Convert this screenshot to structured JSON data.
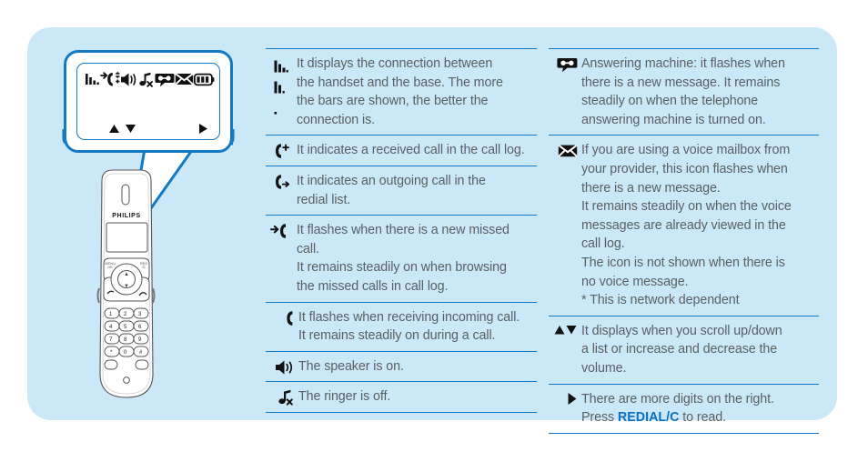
{
  "panel": {
    "background_color": "#cbe8f9",
    "accent_color": "#1479c4",
    "text_color": "#5a5f63",
    "highlight_color": "#0a6fc2"
  },
  "illustration": {
    "callout_label": "handset-display-callout",
    "brand": "PHILIPS",
    "display_icons": [
      "signal-bars-icon",
      "missed-call-icon",
      "speaker-on-icon",
      "ringer-off-icon",
      "answering-machine-icon",
      "voice-mail-icon",
      "battery-icon"
    ],
    "display_bottom_icons": [
      "scroll-up-icon",
      "scroll-down-icon",
      "more-digits-right-icon"
    ],
    "keypad_keys": [
      "1",
      "2",
      "3",
      "4",
      "5",
      "6",
      "7",
      "8",
      "9",
      "*",
      "0",
      "#"
    ]
  },
  "left_column": {
    "rows": [
      {
        "icon": "signal-bars-icon",
        "lines": [
          "It displays the connection between",
          "the handset and the base. The more",
          "the bars are shown, the better the",
          "connection is."
        ]
      },
      {
        "icon": "received-call-icon",
        "lines": [
          "It indicates a received call in the call log."
        ]
      },
      {
        "icon": "outgoing-call-icon",
        "lines": [
          "It indicates an outgoing call in the",
          "redial list."
        ]
      },
      {
        "icon": "missed-call-icon",
        "lines": [
          "It flashes when there is a new missed",
          "call.",
          "It remains steadily on when browsing",
          "the missed calls in call log."
        ]
      },
      {
        "icon": "incoming-call-icon",
        "lines": [
          "It flashes when receiving incoming call.",
          "It remains steadily on during a call."
        ]
      },
      {
        "icon": "speaker-on-icon",
        "lines": [
          "The speaker is on."
        ]
      },
      {
        "icon": "ringer-off-icon",
        "lines": [
          "The ringer is off."
        ]
      }
    ]
  },
  "right_column": {
    "rows": [
      {
        "icon": "answering-machine-icon",
        "lines": [
          "Answering machine: it flashes when",
          "there is a new message. It remains",
          "steadily on when the telephone",
          "answering machine is turned on."
        ]
      },
      {
        "icon": "voice-mail-icon",
        "lines": [
          "If you are using a voice mailbox from",
          "your provider, this icon flashes when",
          "there is a new message.",
          "It remains steadily on when the voice",
          "messages are already viewed in the",
          "call log.",
          "The icon is not shown when there is",
          "no voice message.",
          "* This is network dependent"
        ]
      },
      {
        "icon": "scroll-updown-icon",
        "lines": [
          "It displays when you scroll up/down",
          "a list or increase and decrease the",
          "volume."
        ]
      },
      {
        "icon": "more-digits-right-icon",
        "lines_rich": [
          {
            "text": "There are more digits on the right."
          },
          {
            "prefix": "Press ",
            "bold": "REDIAL/C",
            "suffix": " to read."
          }
        ]
      }
    ]
  }
}
